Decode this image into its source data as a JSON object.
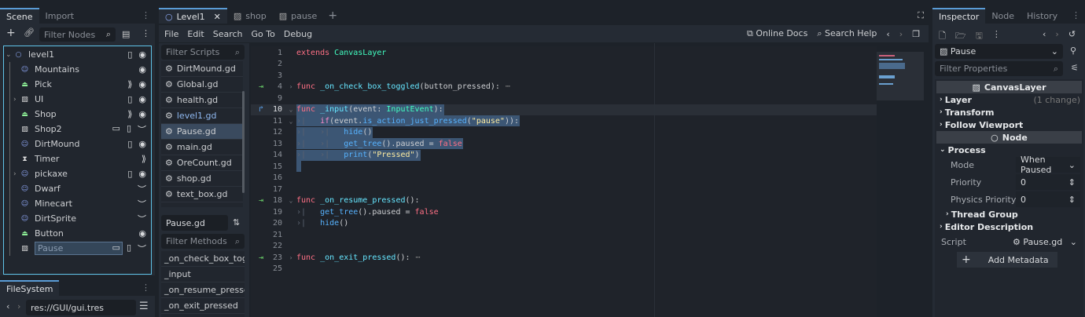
{
  "colors": {
    "accent": "#5a9cd6",
    "tree_border": "#5fc3e8",
    "selection": "#3c5674"
  },
  "scene_dock": {
    "tabs": [
      "Scene",
      "Import"
    ],
    "filter_placeholder": "Filter Nodes",
    "nodes": [
      {
        "label": "level1",
        "icon": "node-circle-icon",
        "depth": 0,
        "expand": "v",
        "badges": [
          "script-icon",
          "eye-icon"
        ]
      },
      {
        "label": "Mountains",
        "icon": "sprite-icon",
        "depth": 1,
        "badges": [
          "eye-icon"
        ]
      },
      {
        "label": "Pick",
        "icon": "area-icon",
        "depth": 1,
        "badges": [
          "signal-icon",
          "eye-icon"
        ]
      },
      {
        "label": "UI",
        "icon": "canvas-layer-icon",
        "depth": 1,
        "expand": ">",
        "badges": [
          "script-icon",
          "eye-icon"
        ]
      },
      {
        "label": "Shop",
        "icon": "area-icon",
        "depth": 1,
        "badges": [
          "signal-icon",
          "eye-icon"
        ]
      },
      {
        "label": "Shop2",
        "icon": "canvas-layer-icon",
        "depth": 1,
        "badges": [
          "clapper-icon",
          "script-icon",
          "hidden-icon"
        ]
      },
      {
        "label": "DirtMound",
        "icon": "sprite-icon",
        "depth": 1,
        "badges": [
          "script-icon",
          "eye-icon"
        ]
      },
      {
        "label": "Timer",
        "icon": "timer-icon",
        "depth": 1,
        "badges": [
          "signal-icon"
        ]
      },
      {
        "label": "pickaxe",
        "icon": "sprite-icon",
        "depth": 1,
        "expand": ">",
        "badges": [
          "script-icon",
          "eye-icon"
        ]
      },
      {
        "label": "Dwarf",
        "icon": "sprite-icon",
        "depth": 1,
        "badges": [
          "hidden-icon"
        ]
      },
      {
        "label": "Minecart",
        "icon": "sprite-icon",
        "depth": 1,
        "badges": [
          "hidden-icon"
        ]
      },
      {
        "label": "DirtSprite",
        "icon": "sprite-icon",
        "depth": 1,
        "badges": [
          "hidden-icon"
        ]
      },
      {
        "label": "Button",
        "icon": "area-icon",
        "depth": 1,
        "badges": [
          "eye-icon"
        ]
      },
      {
        "label": "Pause",
        "icon": "canvas-layer-icon",
        "depth": 1,
        "selected": true,
        "badges": [
          "clapper-icon",
          "script-icon",
          "hidden-icon"
        ]
      }
    ]
  },
  "filesystem": {
    "tab": "FileSystem",
    "path": "res://GUI/gui.tres"
  },
  "editor": {
    "scene_tabs": [
      {
        "label": "Level1",
        "icon": "node-circle-icon",
        "active": true
      },
      {
        "label": "shop",
        "icon": "canvas-layer-icon"
      },
      {
        "label": "pause",
        "icon": "canvas-layer-icon"
      }
    ],
    "menu": [
      "File",
      "Edit",
      "Search",
      "Go To",
      "Debug"
    ],
    "online_docs": "Online Docs",
    "search_help": "Search Help",
    "filter_scripts_placeholder": "Filter Scripts",
    "scripts": [
      "DirtMound.gd",
      "Global.gd",
      "health.gd",
      "level1.gd",
      "Pause.gd",
      "main.gd",
      "OreCount.gd",
      "shop.gd",
      "text_box.gd"
    ],
    "selected_script": "Pause.gd",
    "current_script_label": "Pause.gd",
    "filter_methods_placeholder": "Filter Methods",
    "methods": [
      "_on_check_box_tog...",
      "_input",
      "_on_resume_pressed",
      "_on_exit_pressed"
    ],
    "code": [
      {
        "n": "1",
        "tokens": [
          [
            "kw",
            "extends "
          ],
          [
            "ty",
            "CanvasLayer"
          ]
        ]
      },
      {
        "n": "2",
        "tokens": []
      },
      {
        "n": "3",
        "tokens": []
      },
      {
        "n": "4",
        "marker": "connect",
        "fold": ">",
        "folded": true,
        "tokens": [
          [
            "kw",
            "func "
          ],
          [
            "fn",
            "_on_check_box_toggled"
          ],
          [
            "id",
            "(button_pressed):"
          ]
        ]
      },
      {
        "n": "9",
        "tokens": []
      },
      {
        "n": "10",
        "marker": "override",
        "fold": "v",
        "current": true,
        "sel": true,
        "tokens": [
          [
            "kw",
            "func "
          ],
          [
            "fn",
            "_input"
          ],
          [
            "id",
            "(event: "
          ],
          [
            "ty",
            "InputEvent"
          ],
          [
            "id",
            "):"
          ]
        ]
      },
      {
        "n": "11",
        "fold": "v",
        "sel": true,
        "tabs": 1,
        "tokens": [
          [
            "cf",
            "if"
          ],
          [
            "id",
            "(event."
          ],
          [
            "call",
            "is_action_just_pressed"
          ],
          [
            "id",
            "("
          ],
          [
            "str",
            "\"pause\""
          ],
          [
            "id",
            "))"
          ],
          [
            "id",
            ":"
          ]
        ]
      },
      {
        "n": "12",
        "sel": true,
        "tabs": 2,
        "tokens": [
          [
            "call",
            "hide"
          ],
          [
            "id",
            "()"
          ]
        ]
      },
      {
        "n": "13",
        "sel": true,
        "tabs": 2,
        "tokens": [
          [
            "call",
            "get_tree"
          ],
          [
            "id",
            "().paused = "
          ],
          [
            "kw",
            "false"
          ]
        ]
      },
      {
        "n": "14",
        "sel": true,
        "tabs": 2,
        "tokens": [
          [
            "call",
            "print"
          ],
          [
            "id",
            "("
          ],
          [
            "str",
            "\"Pressed\""
          ],
          [
            "id",
            ")"
          ]
        ]
      },
      {
        "n": "15",
        "sel": true,
        "tokens": []
      },
      {
        "n": "16",
        "tokens": []
      },
      {
        "n": "17",
        "tokens": []
      },
      {
        "n": "18",
        "marker": "connect",
        "fold": "v",
        "tokens": [
          [
            "kw",
            "func "
          ],
          [
            "fn",
            "_on_resume_pressed"
          ],
          [
            "id",
            "():"
          ]
        ]
      },
      {
        "n": "19",
        "tabs": 1,
        "tokens": [
          [
            "call",
            "get_tree"
          ],
          [
            "id",
            "().paused = "
          ],
          [
            "kw",
            "false"
          ]
        ]
      },
      {
        "n": "20",
        "tabs": 1,
        "tokens": [
          [
            "call",
            "hide"
          ],
          [
            "id",
            "()"
          ]
        ]
      },
      {
        "n": "21",
        "tokens": []
      },
      {
        "n": "22",
        "tokens": []
      },
      {
        "n": "23",
        "marker": "connect",
        "fold": ">",
        "folded": true,
        "tokens": [
          [
            "kw",
            "func "
          ],
          [
            "fn",
            "_on_exit_pressed"
          ],
          [
            "id",
            "():"
          ]
        ]
      },
      {
        "n": "25",
        "tokens": []
      }
    ]
  },
  "inspector": {
    "tabs": [
      "Inspector",
      "Node",
      "History"
    ],
    "object": "Pause",
    "filter_placeholder": "Filter Properties",
    "class_header": "CanvasLayer",
    "sections1": [
      {
        "label": "Layer",
        "note": "(1 change)"
      },
      {
        "label": "Transform"
      },
      {
        "label": "Follow Viewport"
      }
    ],
    "node_header": "Node",
    "process_label": "Process",
    "props": [
      {
        "label": "Mode",
        "value": "When Paused",
        "kind": "dropdown"
      },
      {
        "label": "Priority",
        "value": "0",
        "kind": "spin"
      },
      {
        "label": "Physics Priority",
        "value": "0",
        "kind": "spin"
      }
    ],
    "thread_group": "Thread Group",
    "editor_description": "Editor Description",
    "script_label": "Script",
    "script_value": "Pause.gd",
    "add_metadata": "Add Metadata"
  }
}
